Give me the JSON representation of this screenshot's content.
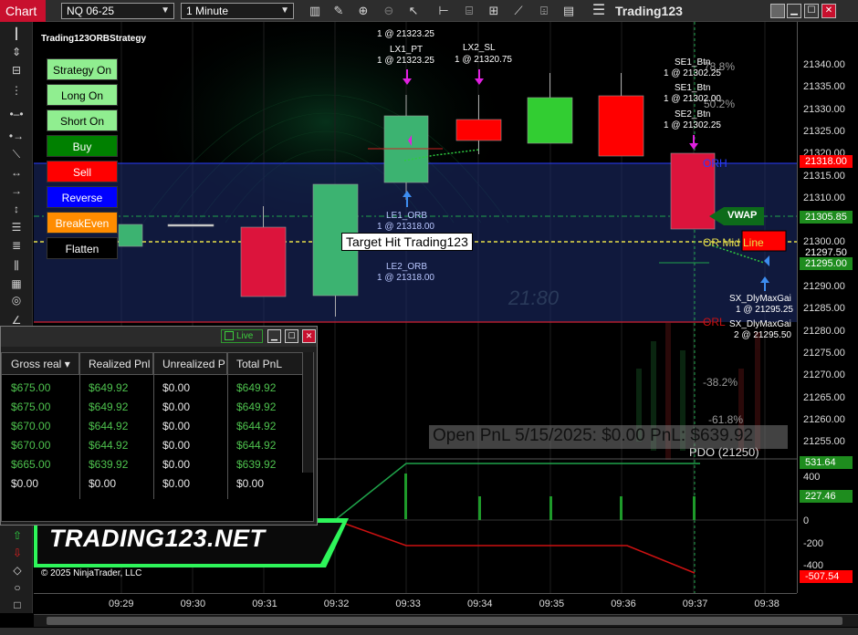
{
  "toolbar": {
    "tab_label": "Chart",
    "instrument": "NQ 06-25",
    "interval": "1 Minute",
    "app_title": "Trading123"
  },
  "chart": {
    "strategy_name": "Trading123ORBStrategy",
    "f_label": "F",
    "buttons": [
      {
        "label": "Strategy On",
        "bg": "#90ee90",
        "fg": "#000000"
      },
      {
        "label": "Long On",
        "bg": "#90ee90",
        "fg": "#000000"
      },
      {
        "label": "Short On",
        "bg": "#90ee90",
        "fg": "#000000"
      },
      {
        "label": "Buy",
        "bg": "#008000",
        "fg": "#ffffff"
      },
      {
        "label": "Sell",
        "bg": "#ff0000",
        "fg": "#ffffff"
      },
      {
        "label": "Reverse",
        "bg": "#0000ff",
        "fg": "#ffffff"
      },
      {
        "label": "BreakEven",
        "bg": "#ff8c00",
        "fg": "#ffffff"
      },
      {
        "label": "Flatten",
        "bg": "#000000",
        "fg": "#ffffff"
      }
    ],
    "annotations": {
      "top_fill": "1 @ 21323.25",
      "lx1_name": "LX1_PT",
      "lx1_fill": "1 @ 21323.25",
      "lx2_name": "LX2_SL",
      "lx2_fill": "1 @ 21320.75",
      "se1_name": "SE1_Btn",
      "se1_fill": "1 @ 21302.25",
      "se1b_name": "SE1_Btn",
      "se1b_fill": "1 @ 21302.00",
      "se2_name": "SE2_Btn",
      "se2_fill": "1 @ 21302.25",
      "le1_name": "LE1_ORB",
      "le1_fill": "1 @ 21318.00",
      "le2_name": "LE2_ORB",
      "le2_fill": "1 @ 21318.00",
      "sx1_name": "SX_DlyMaxGai",
      "sx1_fill": "1 @ 21295.25",
      "sx2_name": "SX_DlyMaxGai",
      "sx2_fill": "2 @ 21295.50",
      "orh": "ORH",
      "orl": "ORL",
      "vwap": "VWAP",
      "or_mid": "OR Mid Line",
      "fib_top": "78.8%",
      "fib_2": "50.2%",
      "fib_382": "-38.2%",
      "fib_618": "-61.8%",
      "pdo": "PDO (21250)",
      "target_hit": "Target Hit Trading123",
      "open_pnl": "Open PnL 5/15/2025: $0.00     PnL: $639.92"
    },
    "price_labels": [
      "21340.00",
      "21335.00",
      "21330.00",
      "21325.00",
      "21320.00",
      "21315.00",
      "21310.00",
      "21305.00",
      "21300.00",
      "21295.00",
      "21290.00",
      "21285.00",
      "21280.00",
      "21275.00",
      "21270.00",
      "21265.00",
      "21260.00",
      "21255.00"
    ],
    "price_tags": [
      {
        "label": "21318.00",
        "bg": "#ff0000",
        "fg": "#ffffff"
      },
      {
        "label": "21305.85",
        "bg": "#1e8c1e",
        "fg": "#ffffff"
      },
      {
        "label": "21297.50",
        "bg": "#000000",
        "fg": "#ffffff"
      },
      {
        "label": "21295.00",
        "bg": "#1e8c1e",
        "fg": "#ffffff"
      }
    ],
    "pnl_axis_labels": [
      "400",
      "200",
      "0",
      "-200",
      "-400"
    ],
    "pnl_tags": [
      {
        "label": "531.64",
        "bg": "#1e8c1e",
        "fg": "#ffffff"
      },
      {
        "label": "227.46",
        "bg": "#1e8c1e",
        "fg": "#ffffff"
      },
      {
        "label": "-507.54",
        "bg": "#ff0000",
        "fg": "#ffffff"
      }
    ],
    "time_labels": [
      "09:29",
      "09:30",
      "09:31",
      "09:32",
      "09:33",
      "09:34",
      "09:35",
      "09:36",
      "09:37",
      "09:38"
    ],
    "watermark": "21:80"
  },
  "pnl_panel": {
    "live_label": "Live",
    "columns": [
      "Gross real",
      "Realized Pnl",
      "Unrealized P",
      "Total PnL"
    ],
    "rows": [
      [
        "$675.00",
        "$649.92",
        "$0.00",
        "$649.92"
      ],
      [
        "$675.00",
        "$649.92",
        "$0.00",
        "$649.92"
      ],
      [
        "$670.00",
        "$644.92",
        "$0.00",
        "$644.92"
      ],
      [
        "$670.00",
        "$644.92",
        "$0.00",
        "$644.92"
      ],
      [
        "$665.00",
        "$639.92",
        "$0.00",
        "$639.92"
      ],
      [
        "$0.00",
        "$0.00",
        "$0.00",
        "$0.00"
      ]
    ]
  },
  "branding": {
    "banner": "TRADING123.NET",
    "copyright": "© 2025 NinjaTrader, LLC"
  }
}
